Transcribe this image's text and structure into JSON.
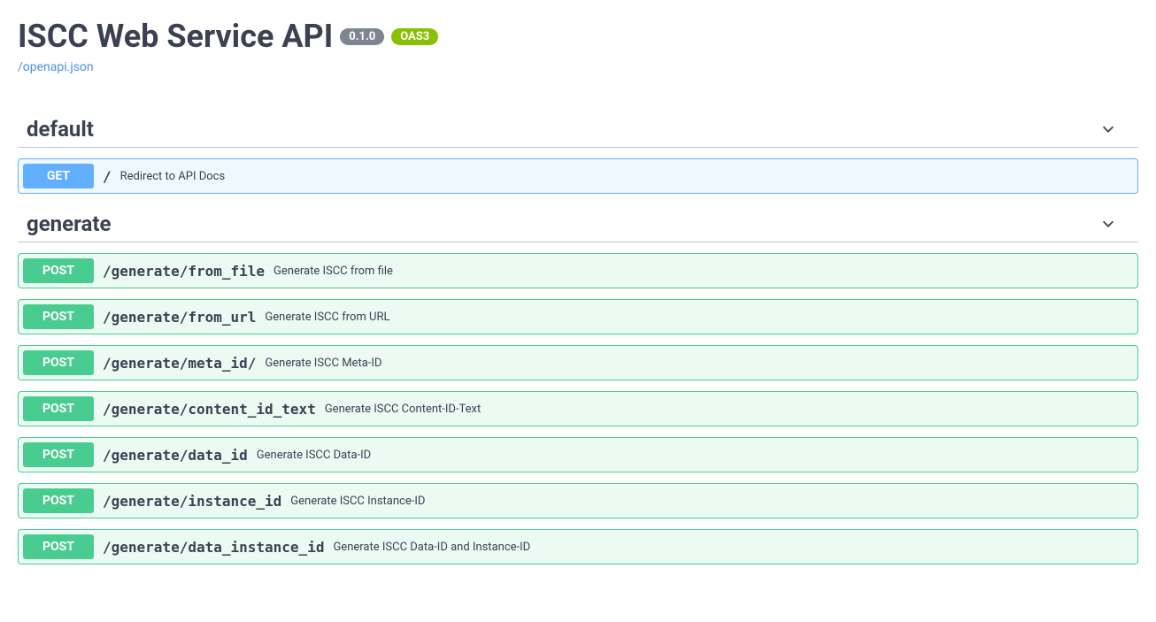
{
  "header": {
    "title": "ISCC Web Service API",
    "version": "0.1.0",
    "oas": "OAS3",
    "spec_link": "/openapi.json"
  },
  "tags": [
    {
      "name": "default",
      "ops": [
        {
          "method": "GET",
          "path": "/",
          "desc": "Redirect to API Docs"
        }
      ]
    },
    {
      "name": "generate",
      "ops": [
        {
          "method": "POST",
          "path": "/generate/from_file",
          "desc": "Generate ISCC from file"
        },
        {
          "method": "POST",
          "path": "/generate/from_url",
          "desc": "Generate ISCC from URL"
        },
        {
          "method": "POST",
          "path": "/generate/meta_id/",
          "desc": "Generate ISCC Meta-ID"
        },
        {
          "method": "POST",
          "path": "/generate/content_id_text",
          "desc": "Generate ISCC Content-ID-Text"
        },
        {
          "method": "POST",
          "path": "/generate/data_id",
          "desc": "Generate ISCC Data-ID"
        },
        {
          "method": "POST",
          "path": "/generate/instance_id",
          "desc": "Generate ISCC Instance-ID"
        },
        {
          "method": "POST",
          "path": "/generate/data_instance_id",
          "desc": "Generate ISCC Data-ID and Instance-ID"
        }
      ]
    }
  ]
}
